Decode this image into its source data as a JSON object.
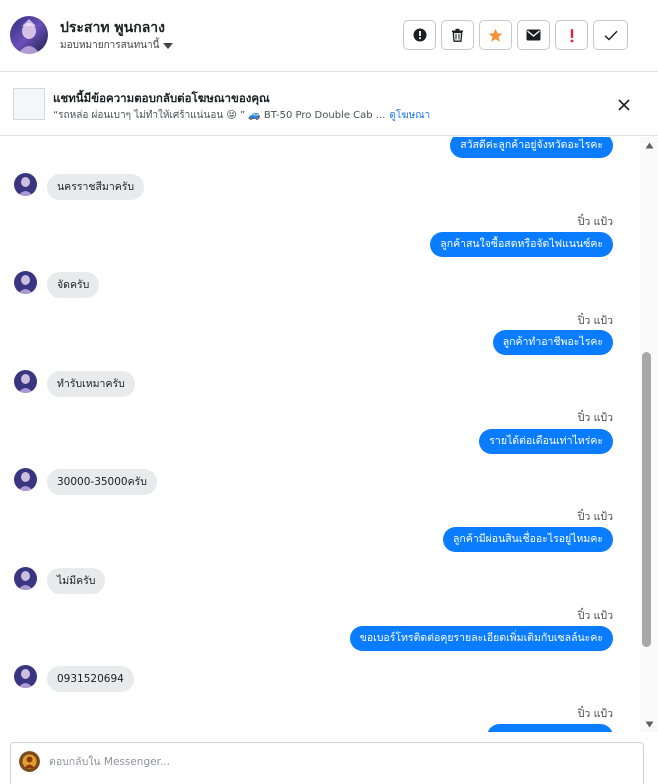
{
  "header": {
    "contact_name": "ประสาท พูนกลาง",
    "assign_label": "มอบหมายการสนทนานี้",
    "actions": [
      {
        "name": "report-button",
        "icon": "alert-circle-icon"
      },
      {
        "name": "delete-button",
        "icon": "trash-icon"
      },
      {
        "name": "star-button",
        "icon": "star-icon"
      },
      {
        "name": "mark-unread-button",
        "icon": "envelope-icon"
      },
      {
        "name": "spam-button",
        "icon": "exclamation-icon"
      },
      {
        "name": "done-button",
        "icon": "checkmark-icon"
      }
    ]
  },
  "banner": {
    "title": "แชทนี้มีข้อความตอบกลับต่อโฆษณาของคุณ",
    "subtitle": "“รถหล่อ ผ่อนเบาๆ ไม่ทำให้เศร้าแน่นอน 😝 ” 🚙 BT-50 Pro Double Cab ...",
    "link": "ดูโฆษณา"
  },
  "messages": [
    {
      "side": "out",
      "text": "สวัสดีค่ะลูกค้าอยู่จังหวัดอะไรคะ"
    },
    {
      "side": "in",
      "text": "นครราชสีมาครับ"
    },
    {
      "side": "out",
      "sender": "ปิ๋ว แป้ว",
      "text": "ลูกค้าสนใจซื้อสดหรือจัดไฟแนนซ์คะ"
    },
    {
      "side": "in",
      "text": "จัดครับ"
    },
    {
      "side": "out",
      "sender": "ปิ๋ว แป้ว",
      "text": "ลูกค้าทำอาชีพอะไรคะ"
    },
    {
      "side": "in",
      "text": "ทำรับเหมาครับ"
    },
    {
      "side": "out",
      "sender": "ปิ๋ว แป้ว",
      "text": "รายได้ต่อเดือนเท่าไหร่คะ"
    },
    {
      "side": "in",
      "text": "30000-35000ครับ"
    },
    {
      "side": "out",
      "sender": "ปิ๋ว แป้ว",
      "text": "ลูกค้ามีผ่อนสินเชื่ออะไรอยู่ไหมคะ"
    },
    {
      "side": "in",
      "text": "ไม่มีครับ"
    },
    {
      "side": "out",
      "sender": "ปิ๋ว แป้ว",
      "text": "ขอเบอร์โทรติดต่อคุยรายละเอียดเพิ่มเติมกับเซลล์นะคะ"
    },
    {
      "side": "in",
      "text": "0931520694"
    },
    {
      "side": "out",
      "sender": "ปิ๋ว แป้ว",
      "text": ""
    }
  ],
  "composer": {
    "placeholder": "ตอบกลับใน Messenger..."
  },
  "colors": {
    "outgoing_bubble": "#0a7cff",
    "incoming_bubble": "#e9eaec",
    "star_active": "#f7923b",
    "link": "#1877f2"
  }
}
